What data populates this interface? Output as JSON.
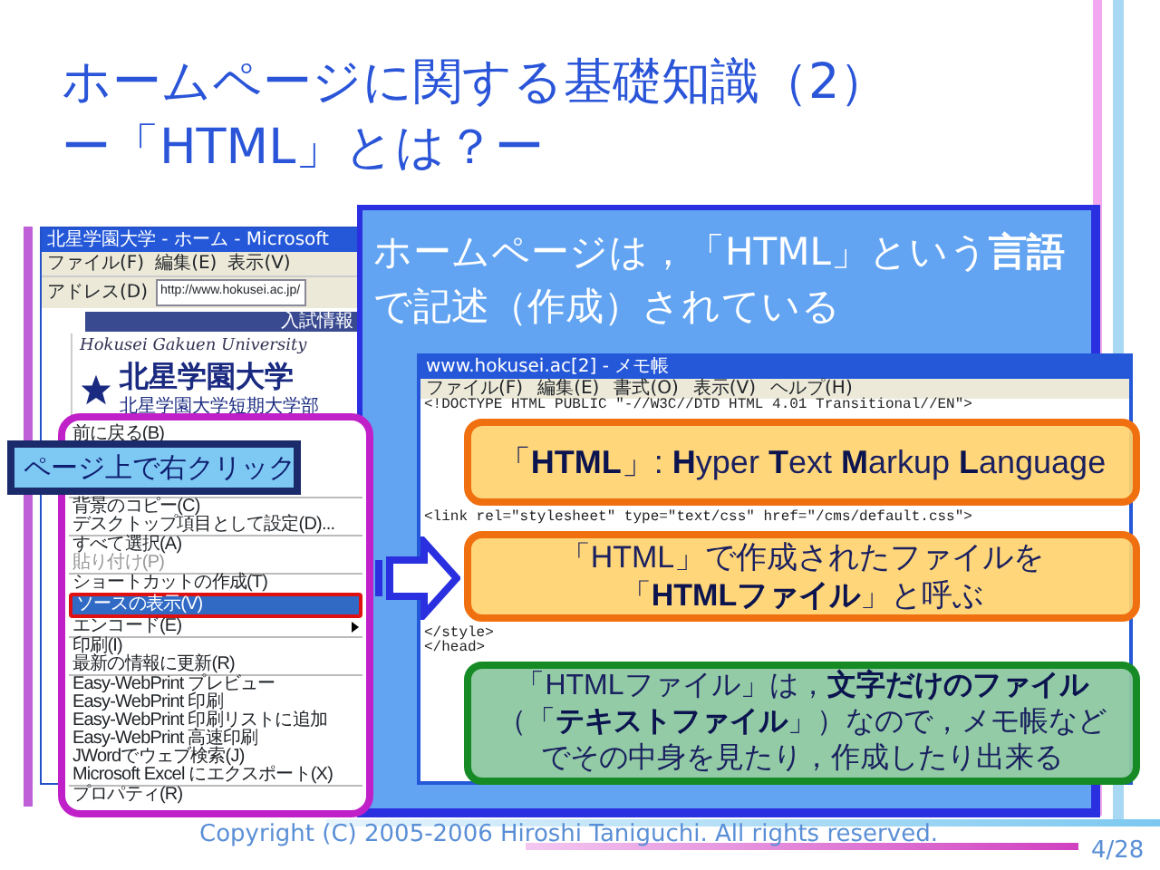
{
  "slide_title": [
    "ホームページに関する基礎知識（2）",
    "ー「HTML」とは？ー"
  ],
  "browser": {
    "title": "北星学園大学 - ホーム - Microsoft",
    "menus": [
      "ファイル(F)",
      "編集(E)",
      "表示(V)"
    ],
    "address_label": "アドレス(D)",
    "address": "http://www.hokusei.ac.jp/",
    "site_name_en": "Hokusei Gakuen University",
    "site_name": "北星学園大学",
    "site_subname": "北星学園大学短期大学部",
    "nav": "入試情報"
  },
  "click_label": "ページ上で右クリック",
  "context_menu": [
    {
      "kind": "item",
      "label": "前に戻る(B)",
      "selected": false,
      "disabled": false,
      "submenu": false
    },
    {
      "kind": "label"
    },
    {
      "kind": "separator"
    },
    {
      "kind": "item",
      "label": "背景のコピー(C)",
      "selected": false,
      "disabled": false,
      "submenu": false
    },
    {
      "kind": "item",
      "label": "デスクトップ項目として設定(D)...",
      "selected": false,
      "disabled": false,
      "submenu": false
    },
    {
      "kind": "separator"
    },
    {
      "kind": "item",
      "label": "すべて選択(A)",
      "selected": false,
      "disabled": false,
      "submenu": false
    },
    {
      "kind": "item",
      "label": "貼り付け(P)",
      "selected": false,
      "disabled": true,
      "submenu": false
    },
    {
      "kind": "separator"
    },
    {
      "kind": "item",
      "label": "ショートカットの作成(T)",
      "selected": false,
      "disabled": false,
      "submenu": false
    },
    {
      "kind": "item",
      "label": "ソースの表示(V)",
      "selected": true,
      "disabled": false,
      "submenu": false
    },
    {
      "kind": "item",
      "label": "エンコード(E)",
      "selected": false,
      "disabled": false,
      "submenu": true
    },
    {
      "kind": "separator"
    },
    {
      "kind": "item",
      "label": "印刷(I)",
      "selected": false,
      "disabled": false,
      "submenu": false
    },
    {
      "kind": "item",
      "label": "最新の情報に更新(R)",
      "selected": false,
      "disabled": false,
      "submenu": false
    },
    {
      "kind": "separator"
    },
    {
      "kind": "item",
      "label": "Easy-WebPrint プレビュー",
      "selected": false,
      "disabled": false,
      "submenu": false
    },
    {
      "kind": "item",
      "label": "Easy-WebPrint 印刷",
      "selected": false,
      "disabled": false,
      "submenu": false
    },
    {
      "kind": "item",
      "label": "Easy-WebPrint 印刷リストに追加",
      "selected": false,
      "disabled": false,
      "submenu": false
    },
    {
      "kind": "item",
      "label": "Easy-WebPrint 高速印刷",
      "selected": false,
      "disabled": false,
      "submenu": false
    },
    {
      "kind": "item",
      "label": "JWordでウェブ検索(J)",
      "selected": false,
      "disabled": false,
      "submenu": false
    },
    {
      "kind": "item",
      "label": "Microsoft Excel にエクスポート(X)",
      "selected": false,
      "disabled": false,
      "submenu": false
    },
    {
      "kind": "separator"
    },
    {
      "kind": "item",
      "label": "プロパティ(R)",
      "selected": false,
      "disabled": false,
      "submenu": false
    }
  ],
  "panel_text": "ホームページは，「HTML」という**言語**で記述（作成）されている",
  "notepad": {
    "title": "www.hokusei.ac[2] - メモ帳",
    "menus": [
      "ファイル(F)",
      "編集(E)",
      "書式(O)",
      "表示(V)",
      "ヘルプ(H)"
    ],
    "blocks": [
      {
        "kind": "code",
        "lines": [
          "<!DOCTYPE HTML PUBLIC \"-//W3C//DTD HTML 4.01 Transitional//EN\">"
        ]
      },
      {
        "kind": "callout",
        "color": "#f07010",
        "lines": [
          "「**HTML**」: **H**yper **T**ext **M**arkup **L**anguage"
        ]
      },
      {
        "kind": "code",
        "lines": [
          "<link rel=\"stylesheet\" type=\"text/css\" href=\"/cms/default.css\">"
        ]
      },
      {
        "kind": "callout",
        "color": "#f07010",
        "lines": [
          "「HTML」で作成されたファイルを",
          "「**HTMLファイル**」と呼ぶ"
        ]
      },
      {
        "kind": "code",
        "lines": [
          "</style>",
          "</head>"
        ]
      },
      {
        "kind": "callout",
        "color": "#158a25",
        "lines": [
          "「HTMLファイル」は，**文字だけのファイル**",
          "（「**テキストファイル**」）なので，メモ帳など",
          "でその中身を見たり，作成したり出来る"
        ]
      }
    ]
  },
  "footer": {
    "copyright": "Copyright (C) 2005-2006 Hiroshi Taniguchi. All rights reserved.",
    "page": "4/28"
  }
}
